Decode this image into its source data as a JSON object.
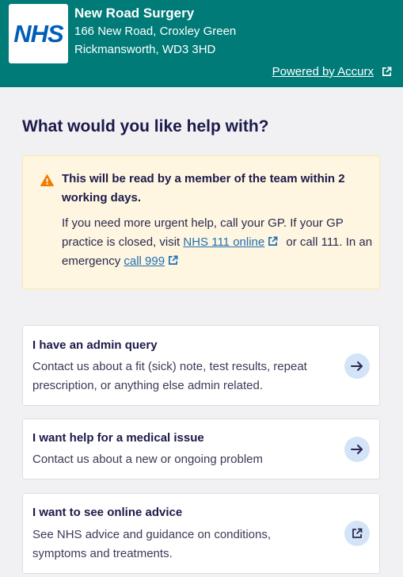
{
  "header": {
    "logo_text": "NHS",
    "practice_name": "New Road Surgery",
    "address_line1": "166 New Road, Croxley Green",
    "address_line2": "Rickmansworth, WD3 3HD",
    "powered_by_label": "Powered by Accurx",
    "background_color": "#007b78"
  },
  "page": {
    "title": "What would you like help with?"
  },
  "alert": {
    "icon": "warning-triangle-icon",
    "title": "This will be read by a member of the team within 2 working days.",
    "body_part1": "If you need more urgent help, call your GP. If your GP practice is closed, visit",
    "nhs111_link": "NHS 111 online",
    "body_part2": "or call 111. In an emergency",
    "call999_link": "call 999"
  },
  "options": [
    {
      "title": "I have an admin query",
      "description": "Contact us about a fit (sick) note, test results, repeat prescription, or anything else admin related.",
      "icon": "arrow-right-icon"
    },
    {
      "title": "I want help for a medical issue",
      "description": "Contact us about a new or ongoing problem",
      "icon": "arrow-right-icon"
    },
    {
      "title": "I want to see online advice",
      "description": "See NHS advice and guidance on conditions, symptoms and treatments.",
      "icon": "external-link-icon"
    }
  ]
}
